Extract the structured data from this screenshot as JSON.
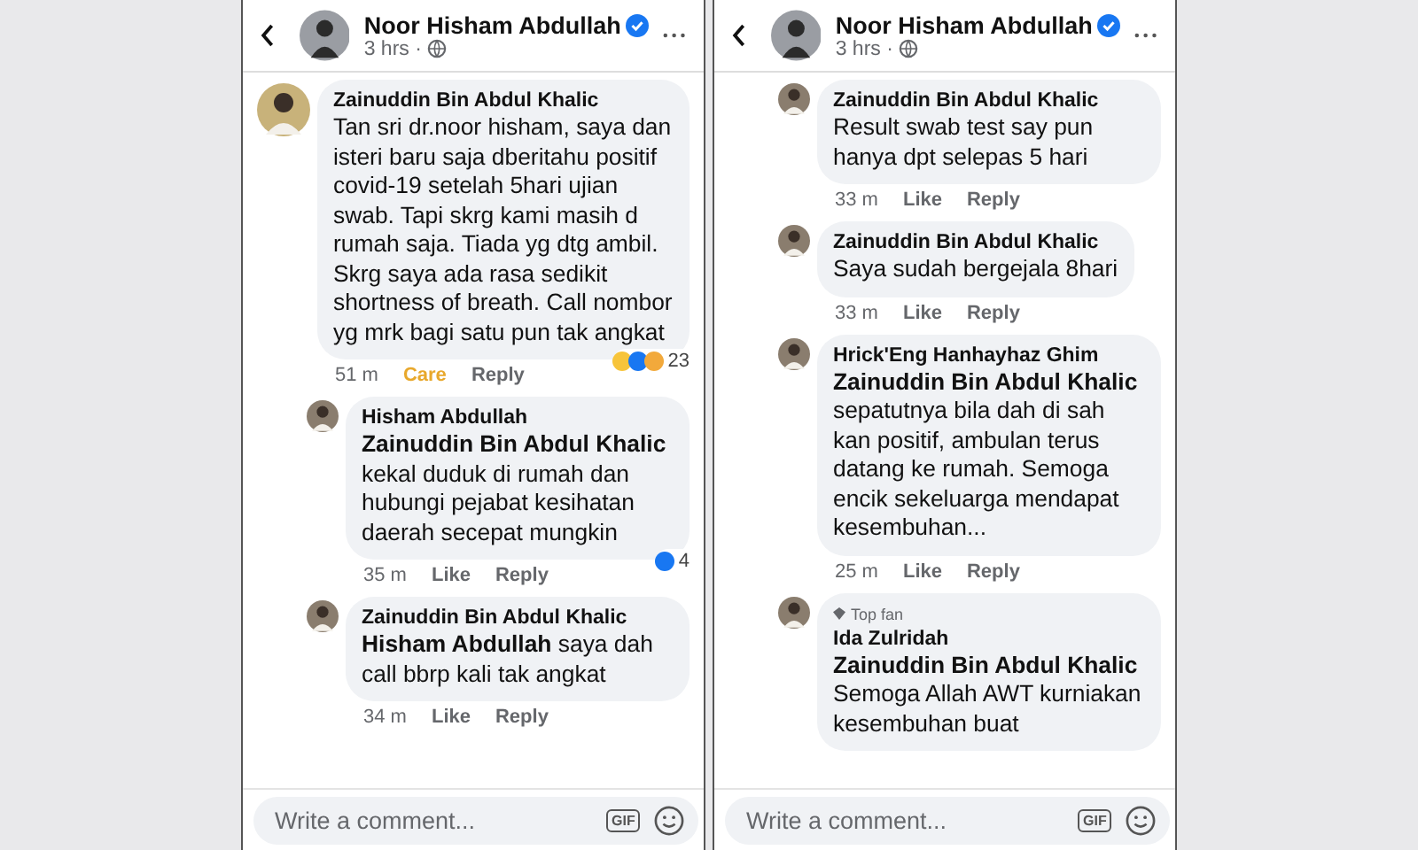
{
  "panels": [
    {
      "header": {
        "name": "Noor Hisham Abdullah",
        "verified": true,
        "time": "3 hrs ·"
      },
      "comments": [
        {
          "kind": "top",
          "author": "Zainuddin Bin Abdul Khalic",
          "text": "Tan sri dr.noor hisham, saya dan isteri baru saja dberitahu positif covid-19 setelah 5hari ujian swab. Tapi skrg kami masih d rumah saja. Tiada yg dtg ambil. Skrg saya ada rasa sedikit shortness of breath. Call nombor yg mrk bagi satu pun tak angkat",
          "time": "51 m",
          "react_label": "Care",
          "reacted": true,
          "reply_label": "Reply",
          "reactions": {
            "icons": [
              {
                "color": "#f7c43a"
              },
              {
                "color": "#1877f2"
              },
              {
                "color": "#f2a93b"
              }
            ],
            "count": "23"
          }
        },
        {
          "kind": "reply",
          "author": "Hisham Abdullah",
          "text": "**Zainuddin Bin Abdul Khalic** kekal duduk di rumah dan hubungi pejabat kesihatan daerah secepat mungkin",
          "time": "35 m",
          "react_label": "Like",
          "reacted": false,
          "reply_label": "Reply",
          "reactions": {
            "icons": [
              {
                "color": "#1877f2"
              }
            ],
            "count": "4"
          }
        },
        {
          "kind": "reply",
          "author": "Zainuddin Bin Abdul Khalic",
          "text": "**Hisham Abdullah** saya dah call bbrp kali tak angkat",
          "time": "34 m",
          "react_label": "Like",
          "reacted": false,
          "reply_label": "Reply"
        }
      ],
      "composer": {
        "placeholder": "Write a comment...",
        "gif": "GIF"
      }
    },
    {
      "header": {
        "name": "Noor Hisham Abdullah",
        "verified": true,
        "time": "3 hrs ·"
      },
      "comments": [
        {
          "kind": "reply",
          "author": "Zainuddin Bin Abdul Khalic",
          "text": "Result swab test say pun hanya dpt selepas 5 hari",
          "time": "33 m",
          "react_label": "Like",
          "reacted": false,
          "reply_label": "Reply"
        },
        {
          "kind": "reply",
          "author": "Zainuddin Bin Abdul Khalic",
          "text": "Saya sudah bergejala 8hari",
          "time": "33 m",
          "react_label": "Like",
          "reacted": false,
          "reply_label": "Reply"
        },
        {
          "kind": "reply",
          "author": "Hrick'Eng Hanhayhaz Ghim",
          "text": "**Zainuddin Bin Abdul Khalic** sepatutnya bila dah di sah kan positif, ambulan terus datang ke rumah. Semoga encik sekeluarga mendapat kesembuhan...",
          "time": "25 m",
          "react_label": "Like",
          "reacted": false,
          "reply_label": "Reply"
        },
        {
          "kind": "reply",
          "badge": "Top fan",
          "author": "Ida Zulridah",
          "text": "**Zainuddin Bin Abdul Khalic** Semoga Allah AWT kurniakan kesembuhan buat"
        }
      ],
      "composer": {
        "placeholder": "Write a comment...",
        "gif": "GIF"
      }
    }
  ]
}
